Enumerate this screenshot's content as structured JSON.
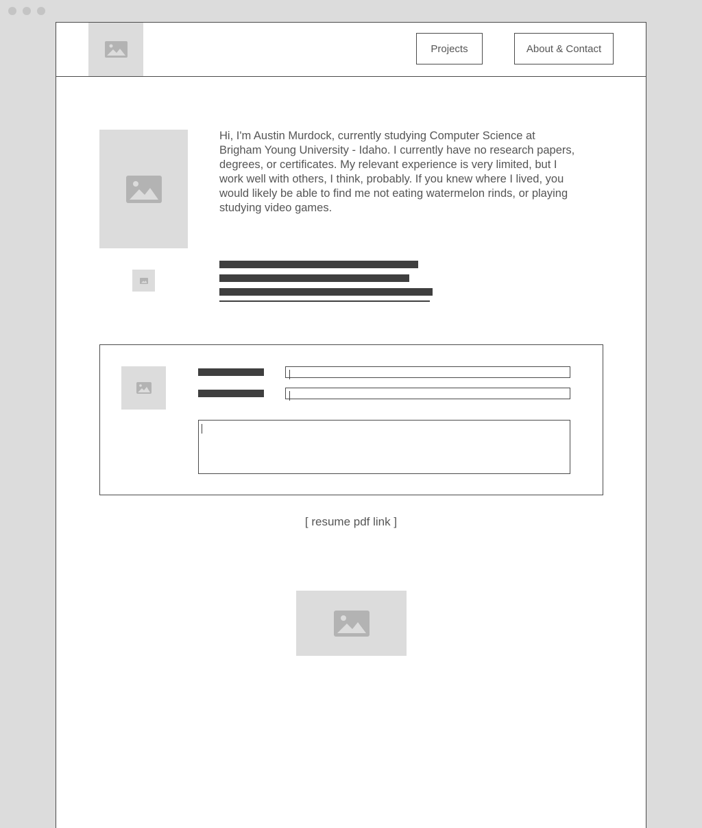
{
  "window": {
    "controls": [
      "close",
      "minimize",
      "maximize"
    ]
  },
  "header": {
    "logo_icon": "image-placeholder-icon",
    "nav": [
      {
        "label": "Projects"
      },
      {
        "label": "About & Contact"
      }
    ]
  },
  "about": {
    "photo_icon": "image-placeholder-icon",
    "bio": "Hi, I'm Austin Murdock, currently studying Computer Science at Brigham Young University - Idaho. I currently have no research papers, degrees, or certificates. My relevant experience is very limited, but I work well with others, I think, probably. If you knew where I lived, you would likely be able to find me not eating watermelon rinds, or playing studying video games."
  },
  "contact_form": {
    "fields": [
      {
        "value": "",
        "placeholder": ""
      },
      {
        "value": "",
        "placeholder": ""
      }
    ],
    "message": {
      "value": "",
      "placeholder": ""
    }
  },
  "resume": {
    "link_text": "[ resume pdf link ]"
  },
  "colors": {
    "background": "#dcdcdc",
    "page": "#ffffff",
    "border": "#4a4a4a",
    "text": "#555555",
    "placeholder_block": "#dcdcdc",
    "text_bar": "#3f3f3f"
  }
}
